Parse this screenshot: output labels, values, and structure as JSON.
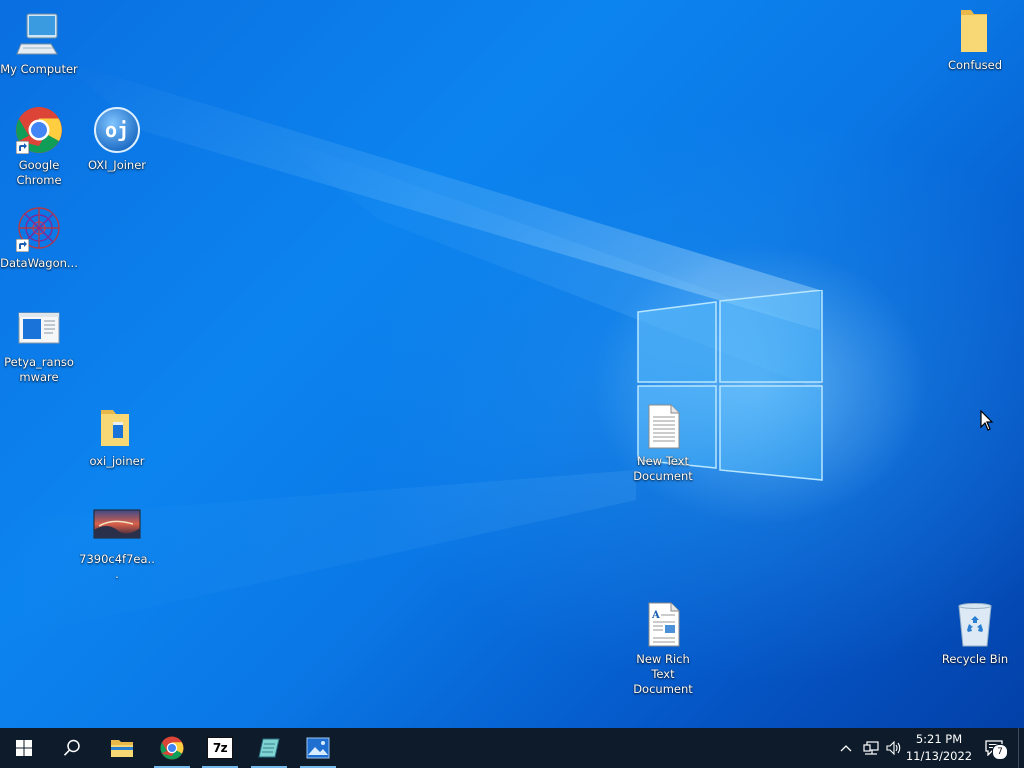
{
  "desktop": {
    "icons": [
      {
        "label": "My Computer"
      },
      {
        "label": "Google Chrome"
      },
      {
        "label": "OXI_Joiner"
      },
      {
        "label": "DataWagon..."
      },
      {
        "label": "Petya_ransomware"
      },
      {
        "label": "oxi_joiner"
      },
      {
        "label": "7390c4f7ea..."
      },
      {
        "label": "New Text Document"
      },
      {
        "label": "New Rich Text Document"
      },
      {
        "label": "Confused"
      },
      {
        "label": "Recycle Bin"
      }
    ],
    "oxi_badge_text": "oj"
  },
  "taskbar": {
    "pinned": [
      {
        "icon": "windows-start-icon"
      },
      {
        "icon": "search-icon"
      },
      {
        "icon": "file-explorer-icon"
      },
      {
        "icon": "chrome-icon"
      },
      {
        "icon": "7zip-icon",
        "text": "7z"
      },
      {
        "icon": "notepad-icon"
      },
      {
        "icon": "photos-icon"
      }
    ],
    "clock": {
      "time": "5:21 PM",
      "date": "11/13/2022"
    },
    "notification_count": "7"
  },
  "colors": {
    "taskbar": "#0d1b2a",
    "desktop_blue": "#0a78e6",
    "active_underline": "#76b9ed"
  }
}
